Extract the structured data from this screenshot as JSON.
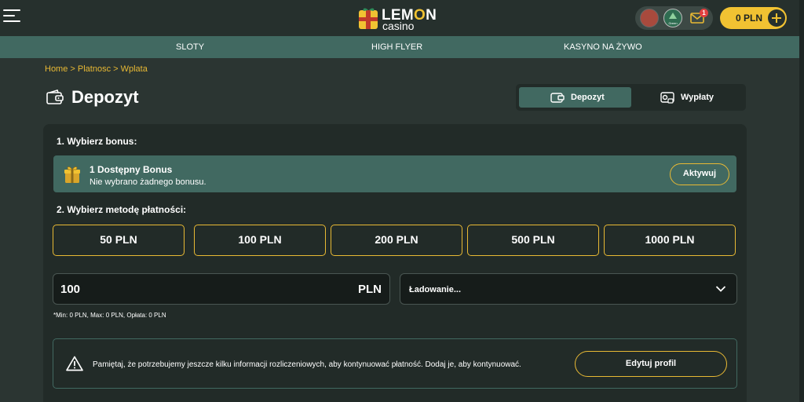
{
  "header": {
    "logo": {
      "word": "LEMON",
      "sub": "casino"
    },
    "user": {
      "level_label": "Green",
      "mail_badge": "1"
    },
    "balance": "0 PLN"
  },
  "nav": {
    "items": [
      "SLOTY",
      "HIGH FLYER",
      "KASYNO NA ŻYWO"
    ]
  },
  "breadcrumb": "Home > Platnosc > Wplata",
  "page_title": "Depozyt",
  "tabs": {
    "deposit": "Depozyt",
    "payout": "Wypłaty"
  },
  "step1": {
    "label": "1. Wybierz bonus:",
    "bonus_title": "1 Dostępny Bonus",
    "bonus_sub": "Nie wybrano żadnego bonusu.",
    "activate": "Aktywuj"
  },
  "step2": {
    "label": "2. Wybierz metodę płatności:",
    "amounts": [
      "50 PLN",
      "100 PLN",
      "200 PLN",
      "500 PLN",
      "1000 PLN"
    ],
    "amount_value": "100",
    "currency": "PLN",
    "method": "Ładowanie...",
    "limits": "*Min: 0 PLN, Max: 0 PLN, Opłata: 0 PLN"
  },
  "notice": {
    "text": "Pamiętaj, że potrzebujemy jeszcze kilku informacji rozliczeniowych, aby kontynuować płatność. Dodaj je, aby kontynuować.",
    "button": "Edytuj profil"
  },
  "colors": {
    "accent": "#e8b934",
    "teal": "#416961",
    "bg": "#2b3532",
    "card": "#222b28"
  }
}
